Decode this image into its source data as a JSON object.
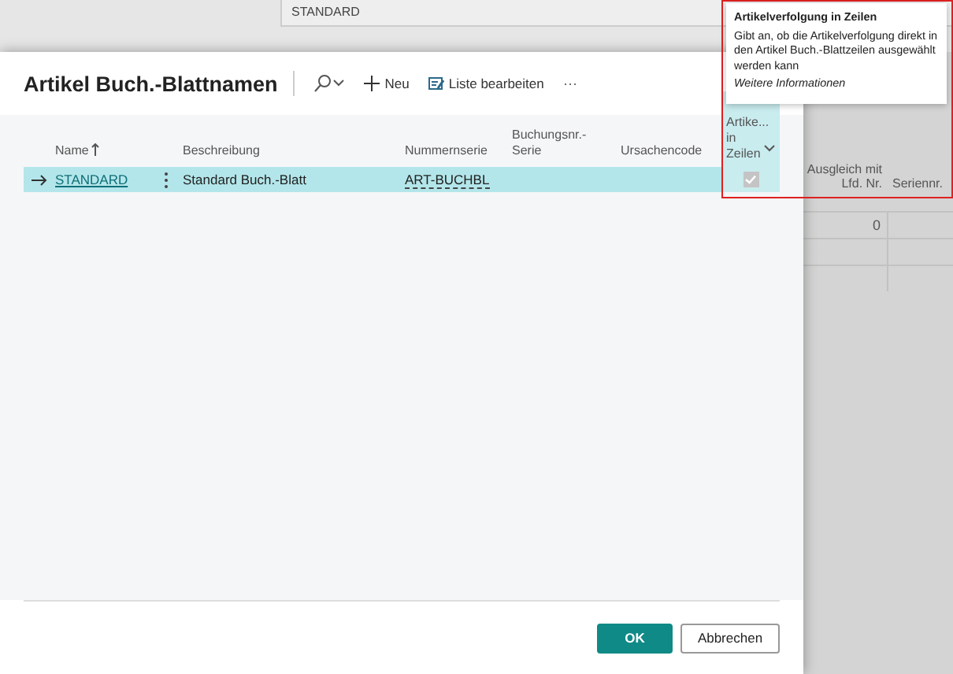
{
  "background": {
    "field_value": "STANDARD",
    "columns": [
      "Ausgleich mit Lfd. Nr.",
      "Seriennr."
    ],
    "first_cell": "0"
  },
  "dialog": {
    "title": "Artikel Buch.-Blattnamen",
    "toolbar": [
      {
        "kind": "search"
      },
      {
        "kind": "new",
        "label": "Neu"
      },
      {
        "kind": "edit",
        "label": "Liste bearbeiten"
      },
      {
        "kind": "more",
        "label": "⋯"
      }
    ],
    "columns": [
      {
        "label": "Name",
        "sorted": true,
        "selected": false
      },
      {
        "label": "Beschreibung",
        "sorted": false,
        "selected": false
      },
      {
        "label": "Nummernserie",
        "sorted": false,
        "selected": false
      },
      {
        "label": "Buchungsnr.-Serie",
        "sorted": false,
        "selected": false
      },
      {
        "label": "Ursachencode",
        "sorted": false,
        "selected": false
      },
      {
        "label": "Artike... in Zeilen",
        "sorted": false,
        "selected": true
      }
    ],
    "rows": [
      {
        "selected": true,
        "name": "STANDARD",
        "description": "Standard Buch.-Blatt",
        "number_series": "ART-BUCHBL",
        "item_tracking": true
      }
    ],
    "buttons": [
      {
        "kind": "primary",
        "label": "OK"
      },
      {
        "kind": "secondary",
        "label": "Abbrechen"
      }
    ]
  },
  "tooltip": {
    "title": "Artikelverfolgung in Zeilen",
    "text": "Gibt an, ob die Artikelverfolgung direkt in den Artikel Buch.-Blattzeilen ausgewählt werden kann",
    "link": "Weitere Informationen"
  }
}
